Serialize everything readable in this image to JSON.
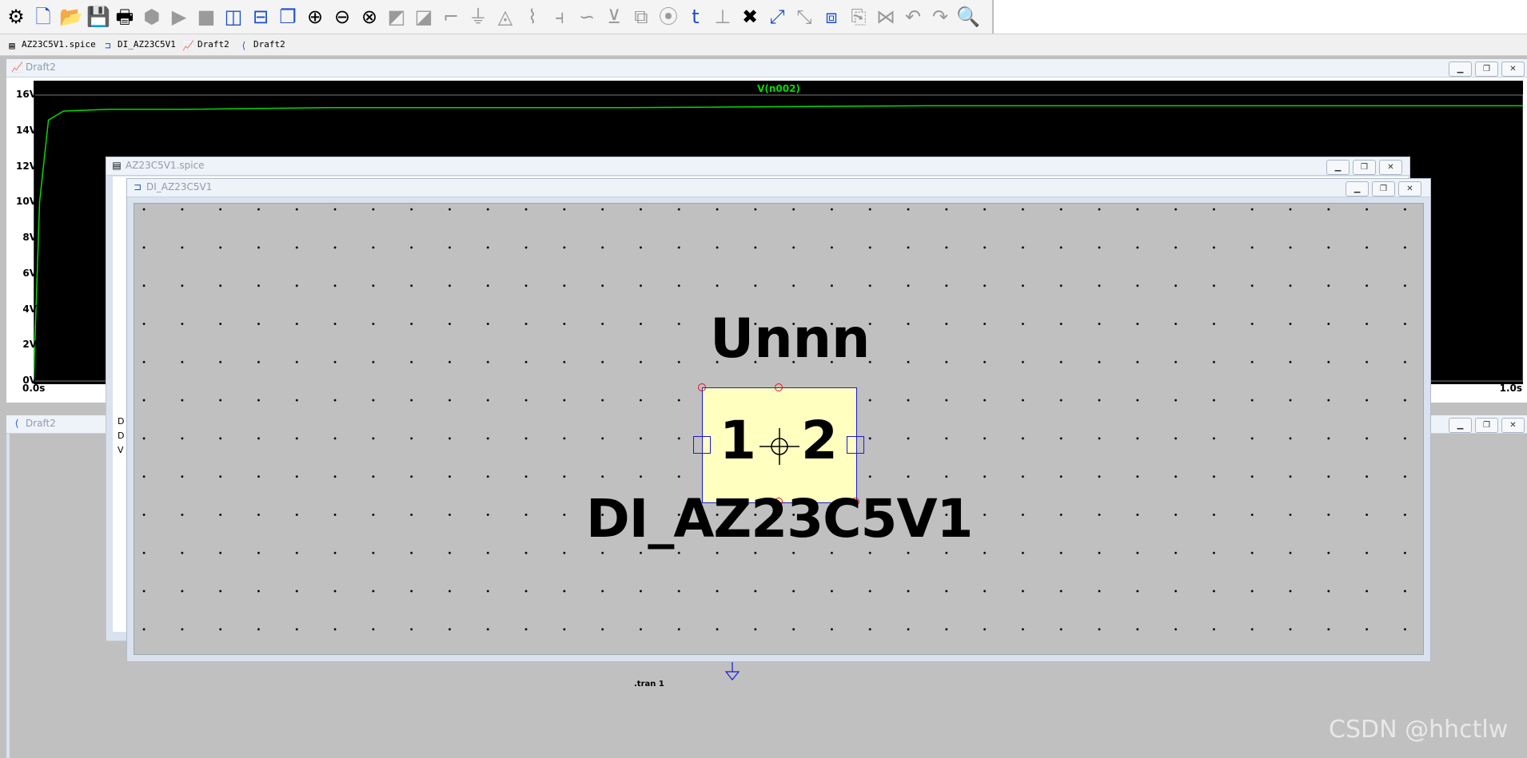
{
  "toolbar": {
    "tools": [
      {
        "name": "settings-icon",
        "glyph": "⚙",
        "tone": "dark"
      },
      {
        "name": "new-schematic-icon",
        "glyph": "🗋",
        "tone": "blue"
      },
      {
        "name": "open-icon",
        "glyph": "📂",
        "tone": "blue"
      },
      {
        "name": "save-icon",
        "glyph": "💾",
        "tone": "dark"
      },
      {
        "name": "print-icon",
        "glyph": "🖶",
        "tone": "dark"
      },
      {
        "name": "halt-icon",
        "glyph": "⬢",
        "tone": "gray"
      },
      {
        "name": "run-icon",
        "glyph": "▶",
        "tone": "gray"
      },
      {
        "name": "stop-icon",
        "glyph": "■",
        "tone": "gray"
      },
      {
        "name": "tile-vertical-icon",
        "glyph": "◫",
        "tone": "blue"
      },
      {
        "name": "tile-horizontal-icon",
        "glyph": "⊟",
        "tone": "blue"
      },
      {
        "name": "cascade-icon",
        "glyph": "❐",
        "tone": "blue"
      },
      {
        "name": "zoom-in-icon",
        "glyph": "⊕",
        "tone": "dark"
      },
      {
        "name": "zoom-out-icon",
        "glyph": "⊖",
        "tone": "dark"
      },
      {
        "name": "zoom-fit-icon",
        "glyph": "⊗",
        "tone": "dark"
      },
      {
        "name": "autorange-icon",
        "glyph": "◩",
        "tone": "gray"
      },
      {
        "name": "waveform-icon",
        "glyph": "◪",
        "tone": "gray"
      },
      {
        "name": "wire-icon",
        "glyph": "⌐",
        "tone": "gray"
      },
      {
        "name": "ground-icon",
        "glyph": "⏚",
        "tone": "gray"
      },
      {
        "name": "label-icon",
        "glyph": "◬",
        "tone": "gray"
      },
      {
        "name": "resistor-icon",
        "glyph": "⌇",
        "tone": "gray"
      },
      {
        "name": "capacitor-icon",
        "glyph": "⫞",
        "tone": "gray"
      },
      {
        "name": "inductor-icon",
        "glyph": "∽",
        "tone": "gray"
      },
      {
        "name": "diode-icon",
        "glyph": "⊻",
        "tone": "gray"
      },
      {
        "name": "component-icon",
        "glyph": "⧉",
        "tone": "gray"
      },
      {
        "name": "spice-directive-icon",
        "glyph": "⦿",
        "tone": "gray"
      },
      {
        "name": "text-icon",
        "glyph": "t",
        "tone": "blue"
      },
      {
        "name": "spice-text-icon",
        "glyph": "⊥",
        "tone": "gray"
      },
      {
        "name": "delete-icon",
        "glyph": "✖",
        "tone": "dark"
      },
      {
        "name": "move-icon",
        "glyph": "⤢",
        "tone": "blue"
      },
      {
        "name": "drag-icon",
        "glyph": "⤡",
        "tone": "gray"
      },
      {
        "name": "copy-icon",
        "glyph": "⧈",
        "tone": "blue"
      },
      {
        "name": "paste-icon",
        "glyph": "⎘",
        "tone": "gray"
      },
      {
        "name": "mirror-icon",
        "glyph": "⋈",
        "tone": "gray"
      },
      {
        "name": "undo-icon",
        "glyph": "↶",
        "tone": "gray"
      },
      {
        "name": "redo-icon",
        "glyph": "↷",
        "tone": "gray"
      },
      {
        "name": "find-icon",
        "glyph": "🔍",
        "tone": "blue"
      }
    ]
  },
  "tabs": [
    {
      "label": "AZ23C5V1.spice",
      "icon": "text-file-icon",
      "glyph": "▤"
    },
    {
      "label": "DI_AZ23C5V1",
      "icon": "symbol-icon",
      "glyph": "⊐"
    },
    {
      "label": "Draft2",
      "icon": "waveform-icon",
      "glyph": "📈"
    },
    {
      "label": "Draft2",
      "icon": "schematic-icon",
      "glyph": "⟨"
    }
  ],
  "windows": {
    "waveform": {
      "title": "Draft2"
    },
    "schematic": {
      "title": "Draft2",
      "directive": ".tran 1"
    },
    "spice": {
      "title": "AZ23C5V1.spice",
      "stray_chars": [
        "D",
        "D",
        "V"
      ]
    },
    "symbol": {
      "title": "DI_AZ23C5V1"
    }
  },
  "symbol": {
    "inst_name": "Unnn",
    "pin1": "1",
    "pin2": "2",
    "value": "DI_AZ23C5V1"
  },
  "chart_data": {
    "type": "line",
    "title": "V(n002)",
    "series": [
      {
        "name": "V(n002)",
        "x": [
          0,
          0.004,
          0.01,
          0.02,
          0.05,
          0.1,
          0.2,
          0.4,
          0.6,
          0.8,
          1.0
        ],
        "y": [
          0,
          10,
          14.6,
          15.1,
          15.2,
          15.2,
          15.3,
          15.3,
          15.4,
          15.4,
          15.4
        ],
        "color": "#00dc00"
      }
    ],
    "xlim": [
      0,
      1
    ],
    "ylim": [
      0,
      16
    ],
    "yticks": [
      "0V",
      "2V",
      "4V",
      "6V",
      "8V",
      "10V",
      "12V",
      "14V",
      "16V"
    ],
    "xticks": [
      "0.0s",
      "1.0s"
    ],
    "background": "#000000",
    "grid": false
  },
  "watermark": "CSDN @hhctlw"
}
